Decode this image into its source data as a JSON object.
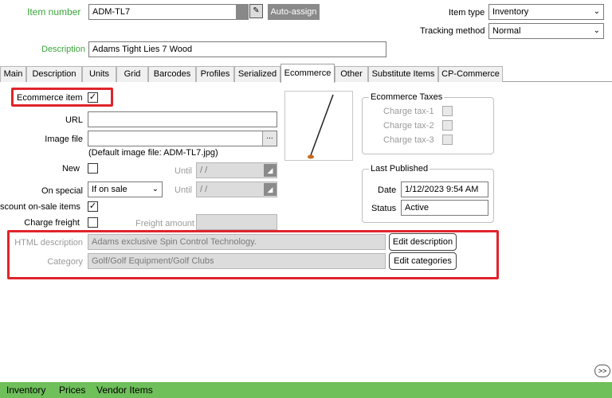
{
  "item": {
    "number_label": "Item number",
    "number_value": "ADM-TL7",
    "auto_assign": "Auto-assign",
    "description_label": "Description",
    "description_value": "Adams Tight Lies 7 Wood",
    "item_type_label": "Item type",
    "item_type_value": "Inventory",
    "tracking_label": "Tracking method",
    "tracking_value": "Normal"
  },
  "tabs": [
    "Main",
    "Description",
    "Units",
    "Grid",
    "Barcodes",
    "Profiles",
    "Serialized",
    "Ecommerce",
    "Other",
    "Substitute Items",
    "CP-Commerce"
  ],
  "ecommerce": {
    "ecommerce_item_label": "Ecommerce item",
    "ecommerce_item_checked": "✓",
    "url_label": "URL",
    "url_value": "",
    "image_file_label": "Image file",
    "image_file_value": "",
    "browse_label": "...",
    "default_image_note": "(Default image file: ADM-TL7.jpg)",
    "new_label": "New",
    "until_label": "Until",
    "until_value": " /  /",
    "on_special_label": "On special",
    "on_special_value": "If on sale",
    "discount_label": "scount on-sale items",
    "discount_checked": "✓",
    "charge_freight_label": "Charge freight",
    "freight_amount_label": "Freight amount",
    "html_desc_label": "HTML description",
    "html_desc_value": "Adams exclusive Spin Control Technology.",
    "edit_desc_button": "Edit description",
    "category_label": "Category",
    "category_value": "Golf/Golf Equipment/Golf Clubs",
    "edit_categories_button": "Edit categories"
  },
  "taxes": {
    "title": "Ecommerce Taxes",
    "items": [
      "Charge tax-1",
      "Charge tax-2",
      "Charge tax-3"
    ]
  },
  "published": {
    "title": "Last Published",
    "date_label": "Date",
    "date_value": "1/12/2023 9:54 AM",
    "status_label": "Status",
    "status_value": "Active"
  },
  "more_button": ">>",
  "bottom_tabs": [
    "Inventory",
    "Prices",
    "Vendor Items"
  ]
}
